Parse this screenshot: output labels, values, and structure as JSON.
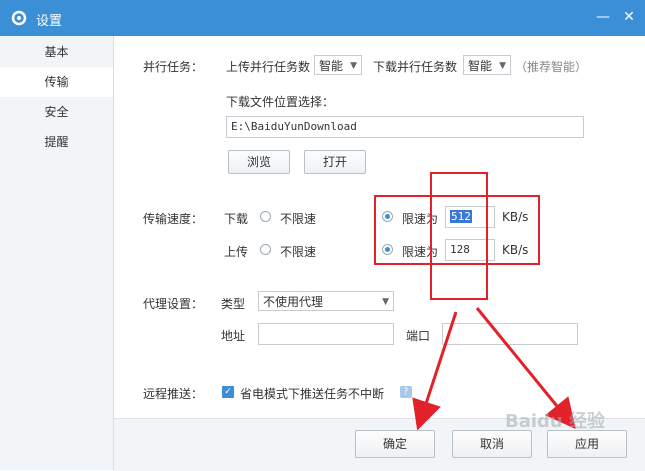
{
  "window": {
    "title": "设置"
  },
  "sidebar": {
    "items": [
      {
        "label": "基本"
      },
      {
        "label": "传输"
      },
      {
        "label": "安全"
      },
      {
        "label": "提醒"
      }
    ]
  },
  "tasks": {
    "section_label": "并行任务：",
    "upload_label": "上传并行任务数",
    "upload_value": "智能",
    "download_label": "下载并行任务数",
    "download_value": "智能",
    "hint": "（推荐智能）"
  },
  "location": {
    "label": "下载文件位置选择：",
    "path": "E:\\BaiduYunDownload",
    "browse_label": "浏览",
    "open_label": "打开"
  },
  "speed": {
    "section_label": "传输速度：",
    "download_label": "下载",
    "upload_label": "上传",
    "unlimited_label": "不限速",
    "limit_label": "限速为",
    "download_value": "512",
    "upload_value": "128",
    "unit": "KB/s"
  },
  "proxy": {
    "section_label": "代理设置：",
    "type_label": "类型",
    "type_value": "不使用代理",
    "address_label": "地址",
    "port_label": "端口"
  },
  "remote": {
    "section_label": "远程推送：",
    "checkbox_label": "省电模式下推送任务不中断"
  },
  "footer": {
    "ok_label": "确定",
    "cancel_label": "取消",
    "apply_label": "应用"
  },
  "colors": {
    "titlebar": "#3a8fd6",
    "annotation": "#e2212b"
  },
  "watermark": "Baidu 经验"
}
